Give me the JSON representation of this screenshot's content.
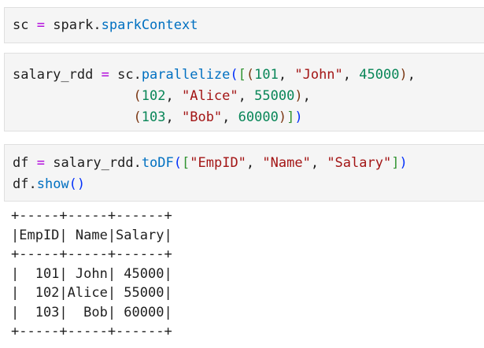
{
  "cells": [
    {
      "tokens": [
        {
          "t": "sc",
          "k": "var"
        },
        {
          "t": " ",
          "k": "p"
        },
        {
          "t": "=",
          "k": "op"
        },
        {
          "t": " spark.",
          "k": "var"
        },
        {
          "t": "sparkContext",
          "k": "attr"
        }
      ]
    },
    {
      "tokens": [
        {
          "t": "salary_rdd",
          "k": "var"
        },
        {
          "t": " ",
          "k": "p"
        },
        {
          "t": "=",
          "k": "op"
        },
        {
          "t": " sc.",
          "k": "var"
        },
        {
          "t": "parallelize",
          "k": "fn"
        },
        {
          "t": "(",
          "k": "b1"
        },
        {
          "t": "[",
          "k": "b2"
        },
        {
          "t": "(",
          "k": "b3"
        },
        {
          "t": "101",
          "k": "num"
        },
        {
          "t": ", ",
          "k": "p"
        },
        {
          "t": "\"John\"",
          "k": "str"
        },
        {
          "t": ", ",
          "k": "p"
        },
        {
          "t": "45000",
          "k": "num"
        },
        {
          "t": ")",
          "k": "b3"
        },
        {
          "t": ",\n",
          "k": "p"
        },
        {
          "t": "               ",
          "k": "p"
        },
        {
          "t": "(",
          "k": "b3"
        },
        {
          "t": "102",
          "k": "num"
        },
        {
          "t": ", ",
          "k": "p"
        },
        {
          "t": "\"Alice\"",
          "k": "str"
        },
        {
          "t": ", ",
          "k": "p"
        },
        {
          "t": "55000",
          "k": "num"
        },
        {
          "t": ")",
          "k": "b3"
        },
        {
          "t": ",\n",
          "k": "p"
        },
        {
          "t": "               ",
          "k": "p"
        },
        {
          "t": "(",
          "k": "b3"
        },
        {
          "t": "103",
          "k": "num"
        },
        {
          "t": ", ",
          "k": "p"
        },
        {
          "t": "\"Bob\"",
          "k": "str"
        },
        {
          "t": ", ",
          "k": "p"
        },
        {
          "t": "60000",
          "k": "num"
        },
        {
          "t": ")",
          "k": "b3"
        },
        {
          "t": "]",
          "k": "b2"
        },
        {
          "t": ")",
          "k": "b1"
        }
      ]
    },
    {
      "tokens": [
        {
          "t": "df",
          "k": "var"
        },
        {
          "t": " ",
          "k": "p"
        },
        {
          "t": "=",
          "k": "op"
        },
        {
          "t": " salary_rdd.",
          "k": "var"
        },
        {
          "t": "toDF",
          "k": "fn"
        },
        {
          "t": "(",
          "k": "b1"
        },
        {
          "t": "[",
          "k": "b2"
        },
        {
          "t": "\"EmpID\"",
          "k": "str"
        },
        {
          "t": ", ",
          "k": "p"
        },
        {
          "t": "\"Name\"",
          "k": "str"
        },
        {
          "t": ", ",
          "k": "p"
        },
        {
          "t": "\"Salary\"",
          "k": "str"
        },
        {
          "t": "]",
          "k": "b2"
        },
        {
          "t": ")",
          "k": "b1"
        },
        {
          "t": "\n",
          "k": "p"
        },
        {
          "t": "df.",
          "k": "var"
        },
        {
          "t": "show",
          "k": "fn"
        },
        {
          "t": "(",
          "k": "b1"
        },
        {
          "t": ")",
          "k": "b1"
        }
      ]
    }
  ],
  "output": {
    "lines": [
      "+-----+-----+------+",
      "|EmpID| Name|Salary|",
      "+-----+-----+------+",
      "|  101| John| 45000|",
      "|  102|Alice| 55000|",
      "|  103|  Bob| 60000|",
      "+-----+-----+------+"
    ]
  },
  "colors": {
    "cell_bg": "#f5f5f5",
    "keyword_op": "#af00db",
    "attribute": "#0070c1",
    "number": "#098658",
    "string": "#a31515"
  }
}
